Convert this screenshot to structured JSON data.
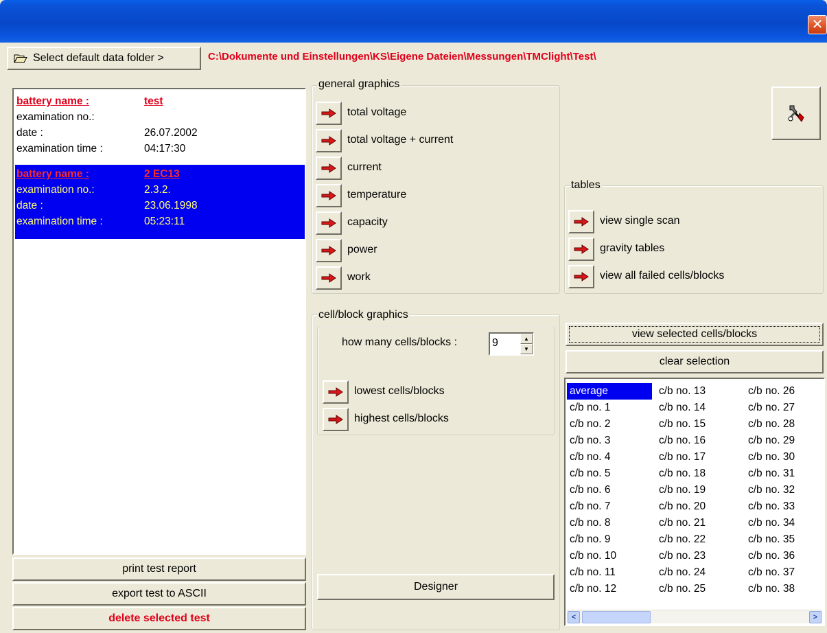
{
  "window": {
    "close_glyph": "✕"
  },
  "folder": {
    "button_label": "Select default data folder >",
    "path": "C:\\Dokumente und Einstellungen\\KS\\Eigene Dateien\\Messungen\\TMClight\\Test\\"
  },
  "tests": [
    {
      "name_label": "battery name :",
      "name": "test",
      "exam_no_label": "examination no.:",
      "exam_no": "",
      "date_label": "date :",
      "date": "26.07.2002",
      "time_label": "examination time :",
      "time": "04:17:30"
    },
    {
      "name_label": "battery name :",
      "name": "2 EC13",
      "exam_no_label": "examination no.:",
      "exam_no": "2.3.2.",
      "date_label": "date :",
      "date": "23.06.1998",
      "time_label": "examination time :",
      "time": "05:23:11"
    }
  ],
  "left_buttons": {
    "print": "print test report",
    "export": "export test to ASCII",
    "delete": "delete selected test"
  },
  "general_graphics": {
    "title": "general graphics",
    "items": [
      "total voltage",
      "total voltage + current",
      "current",
      "temperature",
      "capacity",
      "power",
      "work"
    ]
  },
  "tables": {
    "title": "tables",
    "items": [
      "view single scan",
      "gravity tables",
      "view all failed cells/blocks"
    ]
  },
  "cell_block_graphics": {
    "title": "cell/block graphics",
    "count_label": "how many cells/blocks :",
    "count_value": "9",
    "lowest": "lowest cells/blocks",
    "highest": "highest cells/blocks",
    "designer": "Designer"
  },
  "selection": {
    "view_selected": "view selected cells/blocks",
    "clear": "clear selection"
  },
  "cells": {
    "col1": [
      "average",
      "c/b no. 1",
      "c/b no. 2",
      "c/b no. 3",
      "c/b no. 4",
      "c/b no. 5",
      "c/b no. 6",
      "c/b no. 7",
      "c/b no. 8",
      "c/b no. 9",
      "c/b no. 10",
      "c/b no. 11",
      "c/b no. 12"
    ],
    "col2": [
      "c/b no. 13",
      "c/b no. 14",
      "c/b no. 15",
      "c/b no. 16",
      "c/b no. 17",
      "c/b no. 18",
      "c/b no. 19",
      "c/b no. 20",
      "c/b no. 21",
      "c/b no. 22",
      "c/b no. 23",
      "c/b no. 24",
      "c/b no. 25"
    ],
    "col3": [
      "c/b no. 26",
      "c/b no. 27",
      "c/b no. 28",
      "c/b no. 29",
      "c/b no. 30",
      "c/b no. 31",
      "c/b no. 32",
      "c/b no. 33",
      "c/b no. 34",
      "c/b no. 35",
      "c/b no. 36",
      "c/b no. 37",
      "c/b no. 38"
    ]
  },
  "colors": {
    "accent_red": "#e0001a",
    "selection_blue": "#0000f0",
    "face": "#ece9d8"
  },
  "icons": {
    "folder": "folder-open-icon",
    "arrow": "red-arrow-right-icon",
    "tools": "tools-icon"
  }
}
